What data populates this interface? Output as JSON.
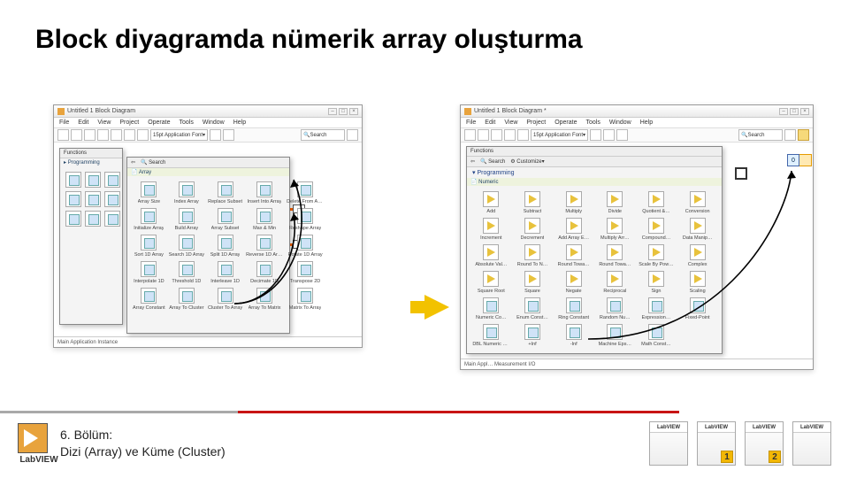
{
  "title": "Block diyagramda nümerik array oluşturma",
  "left_window": {
    "title": "Untitled 1 Block Diagram",
    "menu": [
      "File",
      "Edit",
      "View",
      "Project",
      "Operate",
      "Tools",
      "Window",
      "Help"
    ],
    "toolbar_font": "15pt Application Font",
    "toolbar_search": "Search",
    "status": "Main Application Instance",
    "palette1": {
      "title": "Functions",
      "crumb": "Programming"
    },
    "palette2": {
      "title": "Array",
      "crumb_search": "Search",
      "items": [
        "Array Size",
        "Index Array",
        "Replace Subset",
        "Insert Into Array",
        "Delete From Array",
        "Initialize Array",
        "Build Array",
        "Array Subset",
        "Max & Min",
        "Reshape Array",
        "Sort 1D Array",
        "Search 1D Array",
        "Split 1D Array",
        "Reverse 1D Array",
        "Rotate 1D Array",
        "Interpolate 1D",
        "Threshold 1D",
        "Interleave 1D",
        "Decimate 1D",
        "Transpose 2D",
        "Array Constant",
        "Array To Cluster",
        "Cluster To Array",
        "Array To Matrix",
        "Matrix To Array"
      ]
    }
  },
  "right_window": {
    "title": "Untitled 1 Block Diagram *",
    "menu": [
      "File",
      "Edit",
      "View",
      "Project",
      "Operate",
      "Tools",
      "Window",
      "Help"
    ],
    "toolbar_font": "15pt Application Font",
    "toolbar_search": "Search",
    "status": "Main Appl…  Measurement I/O",
    "palette": {
      "title": "Functions",
      "crumb": "Programming",
      "sub": "Numeric",
      "items": [
        "Add",
        "Subtract",
        "Multiply",
        "Divide",
        "Quotient &…",
        "Conversion",
        "Increment",
        "Decrement",
        "Add Array E…",
        "Multiply Arr…",
        "Compound…",
        "Data Manip…",
        "Absolute Val…",
        "Round To N…",
        "Round Towa…",
        "Round Towa…",
        "Scale By Pow…",
        "Complex",
        "Square Root",
        "Square",
        "Negate",
        "Reciprocal",
        "Sign",
        "Scaling",
        "Numeric Co…",
        "Enum Const…",
        "Ring Constant",
        "Random Nu…",
        "Expression…",
        "Fixed-Point",
        "DBL Numeric Constant",
        "+Inf",
        "-Inf",
        "Machine Eps…",
        "Math Const…"
      ]
    },
    "array_index": "0"
  },
  "footer": {
    "chapter_line1": "6. Bölüm:",
    "chapter_line2": "Dizi (Array) ve Küme (Cluster)",
    "logo_text": "LabVIEW",
    "books": [
      {
        "label": "LabVIEW",
        "num": ""
      },
      {
        "label": "LabVIEW",
        "num": "1"
      },
      {
        "label": "LabVIEW",
        "num": "2"
      },
      {
        "label": "LabVIEW",
        "num": ""
      }
    ]
  }
}
